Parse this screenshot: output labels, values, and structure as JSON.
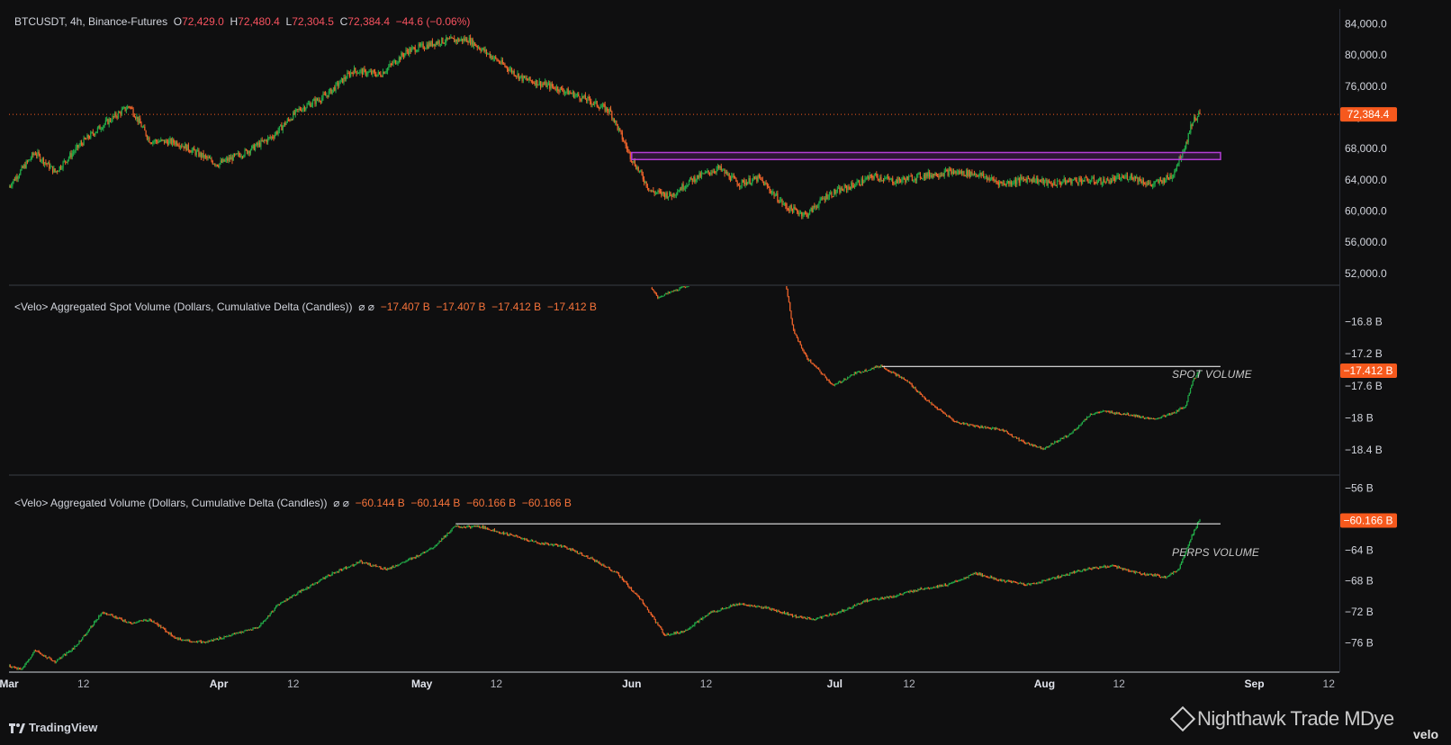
{
  "header": {
    "symbol": "BTCUSDT, 4h, Binance-Futures",
    "open_label": "O",
    "open": "72,429.0",
    "high_label": "H",
    "high": "72,480.4",
    "low_label": "L",
    "low": "72,304.5",
    "close_label": "C",
    "close": "72,384.4",
    "change": "−44.6 (−0.06%)"
  },
  "spot_header": {
    "title": "<Velo> Aggregated Spot Volume (Dollars, Cumulative Delta (Candles))",
    "icons": "⌀ ⌀",
    "values": "−17.407 B  −17.407 B  −17.412 B  −17.412 B"
  },
  "perp_header": {
    "title": "<Velo> Aggregated Volume (Dollars, Cumulative Delta (Candles))",
    "icons": "⌀ ⌀",
    "values": "−60.144 B  −60.144 B  −60.166 B  −60.166 B"
  },
  "annotations": {
    "spot": "SPOT VOLUME",
    "perps": "PERPS VOLUME"
  },
  "branding": {
    "platform": "TradingView",
    "watermark": "Nighthawk Trade MDye",
    "velo": "velo"
  },
  "colors": {
    "up": "#22ab48",
    "down": "#f0642b",
    "price_tag": "#f6591d",
    "zone": "#b43ed6",
    "bg": "#0f0f10"
  },
  "chart_data": [
    {
      "type": "line",
      "title": "BTCUSDT, 4h, Binance-Futures",
      "style": "candlestick",
      "y_ticks": [
        "84,000.0",
        "80,000.0",
        "76,000.0",
        "72,000.0",
        "68,000.0",
        "64,000.0",
        "60,000.0",
        "56,000.0",
        "52,000.0"
      ],
      "y_tick_values": [
        84000,
        80000,
        76000,
        72000,
        68000,
        64000,
        60000,
        56000,
        52000
      ],
      "ylim": [
        50600,
        85900
      ],
      "last_value_label": "72,384.4",
      "last_value": 72384.4,
      "resistance_zone": {
        "from": "Jun 1",
        "to": "Aug 27",
        "low": 66600,
        "high": 67500
      },
      "x": [
        "Mar 1",
        "Mar 5",
        "Mar 8",
        "Mar 12",
        "Mar 15",
        "Mar 19",
        "Mar 22",
        "Mar 26",
        "Apr 1",
        "Apr 5",
        "Apr 9",
        "Apr 13",
        "Apr 17",
        "Apr 21",
        "Apr 25",
        "Apr 29",
        "May 4",
        "May 8",
        "May 12",
        "May 16",
        "May 21",
        "May 25",
        "May 29",
        "Jun 1",
        "Jun 4",
        "Jun 7",
        "Jun 10",
        "Jun 14",
        "Jun 17",
        "Jun 20",
        "Jun 24",
        "Jun 27",
        "Jun 30",
        "Jul 3",
        "Jul 7",
        "Jul 10",
        "Jul 14",
        "Jul 18",
        "Jul 22",
        "Jul 26",
        "Jul 30",
        "Aug 2",
        "Aug 6",
        "Aug 10",
        "Aug 14",
        "Aug 17",
        "Aug 20",
        "Aug 22",
        "Aug 23",
        "Aug 24"
      ],
      "values": [
        63000,
        67500,
        65000,
        68800,
        71000,
        73500,
        69000,
        68800,
        66000,
        67500,
        69500,
        73000,
        74800,
        78000,
        77500,
        80500,
        81800,
        82000,
        79500,
        77000,
        75800,
        74500,
        72800,
        67000,
        62500,
        62000,
        64000,
        65500,
        63500,
        64200,
        60500,
        59500,
        62000,
        63000,
        64500,
        63800,
        64500,
        65000,
        64800,
        63500,
        64200,
        63500,
        64000,
        63800,
        64500,
        63300,
        64500,
        68500,
        71500,
        72384
      ]
    },
    {
      "type": "line",
      "title": "<Velo> Aggregated Spot Volume (Dollars, Cumulative Delta (Candles))",
      "style": "candlestick",
      "y_ticks": [
        "−16.8 B",
        "−17.2 B",
        "−17.6 B",
        "−18 B",
        "−18.4 B"
      ],
      "y_tick_values": [
        -16.8,
        -17.2,
        -17.6,
        -18,
        -18.4
      ],
      "ylim": [
        -18.7,
        -16.36
      ],
      "last_value_label": "−17.412 B",
      "last_value": -17.412,
      "reference_line": {
        "from": "Jul 8",
        "to": "Aug 27",
        "value": -17.36
      },
      "x": [
        "Jun 4",
        "Jun 5",
        "Jun 17",
        "Jun 24",
        "Jun 25",
        "Jun 27",
        "Jul 1",
        "Jul 4",
        "Jul 8",
        "Jul 12",
        "Jul 15",
        "Jul 19",
        "Jul 22",
        "Jul 26",
        "Jul 29",
        "Aug 1",
        "Aug 5",
        "Aug 8",
        "Aug 10",
        "Aug 14",
        "Aug 17",
        "Aug 20",
        "Aug 22",
        "Aug 23",
        "Aug 24"
      ],
      "values": [
        -16.38,
        -16.5,
        -16.1,
        -16.35,
        -16.9,
        -17.25,
        -17.6,
        -17.45,
        -17.35,
        -17.55,
        -17.8,
        -18.05,
        -18.1,
        -18.15,
        -18.3,
        -18.38,
        -18.2,
        -17.95,
        -17.92,
        -17.96,
        -18.02,
        -17.95,
        -17.85,
        -17.55,
        -17.41
      ]
    },
    {
      "type": "line",
      "title": "<Velo> Aggregated Volume (Dollars, Cumulative Delta (Candles))",
      "style": "candlestick",
      "y_ticks": [
        "−56 B",
        "−64 B",
        "−68 B",
        "−72 B",
        "−76 B"
      ],
      "y_tick_values": [
        -56,
        -64,
        -68,
        -72,
        -76
      ],
      "ylim": [
        -79.7,
        -54.4
      ],
      "last_value_label": "−60.166 B",
      "last_value": -60.166,
      "reference_line": {
        "from": "May 6",
        "to": "Aug 27",
        "value": -60.6
      },
      "x": [
        "Mar 1",
        "Mar 3",
        "Mar 5",
        "Mar 8",
        "Mar 11",
        "Mar 15",
        "Mar 19",
        "Mar 22",
        "Mar 26",
        "Mar 30",
        "Apr 3",
        "Apr 7",
        "Apr 10",
        "Apr 14",
        "Apr 18",
        "Apr 22",
        "Apr 26",
        "Apr 30",
        "May 3",
        "May 6",
        "May 10",
        "May 14",
        "May 18",
        "May 22",
        "May 26",
        "May 30",
        "Jun 3",
        "Jun 6",
        "Jun 9",
        "Jun 13",
        "Jun 17",
        "Jun 21",
        "Jun 25",
        "Jun 28",
        "Jul 2",
        "Jul 6",
        "Jul 10",
        "Jul 14",
        "Jul 18",
        "Jul 22",
        "Jul 26",
        "Jul 30",
        "Aug 3",
        "Aug 7",
        "Aug 11",
        "Aug 15",
        "Aug 19",
        "Aug 21",
        "Aug 23",
        "Aug 24"
      ],
      "values": [
        -79,
        -79.5,
        -77,
        -78.5,
        -76.5,
        -72,
        -73.5,
        -73,
        -75.5,
        -76,
        -75,
        -74,
        -71,
        -69,
        -67,
        -65.5,
        -66.5,
        -65,
        -63.5,
        -61,
        -61,
        -62,
        -63,
        -63.5,
        -65,
        -67,
        -71,
        -75,
        -74.5,
        -72,
        -71,
        -71.5,
        -72.5,
        -73,
        -72,
        -70.5,
        -70,
        -69,
        -68.5,
        -67,
        -68,
        -68.5,
        -67.5,
        -66.5,
        -66,
        -67,
        -67.5,
        -66.5,
        -62,
        -60.17
      ]
    }
  ],
  "x_axis": {
    "labels": [
      "Mar",
      "12",
      "Apr",
      "12",
      "May",
      "12",
      "Jun",
      "12",
      "Jul",
      "12",
      "Aug",
      "12",
      "Sep",
      "12"
    ],
    "bold": [
      true,
      false,
      true,
      false,
      true,
      false,
      true,
      false,
      true,
      false,
      true,
      false,
      true,
      false
    ],
    "dates": [
      "Mar 1",
      "Mar 12",
      "Apr 1",
      "Apr 12",
      "May 1",
      "May 12",
      "Jun 1",
      "Jun 12",
      "Jul 1",
      "Jul 12",
      "Aug 1",
      "Aug 12",
      "Sep 1",
      "Sep 12"
    ]
  }
}
